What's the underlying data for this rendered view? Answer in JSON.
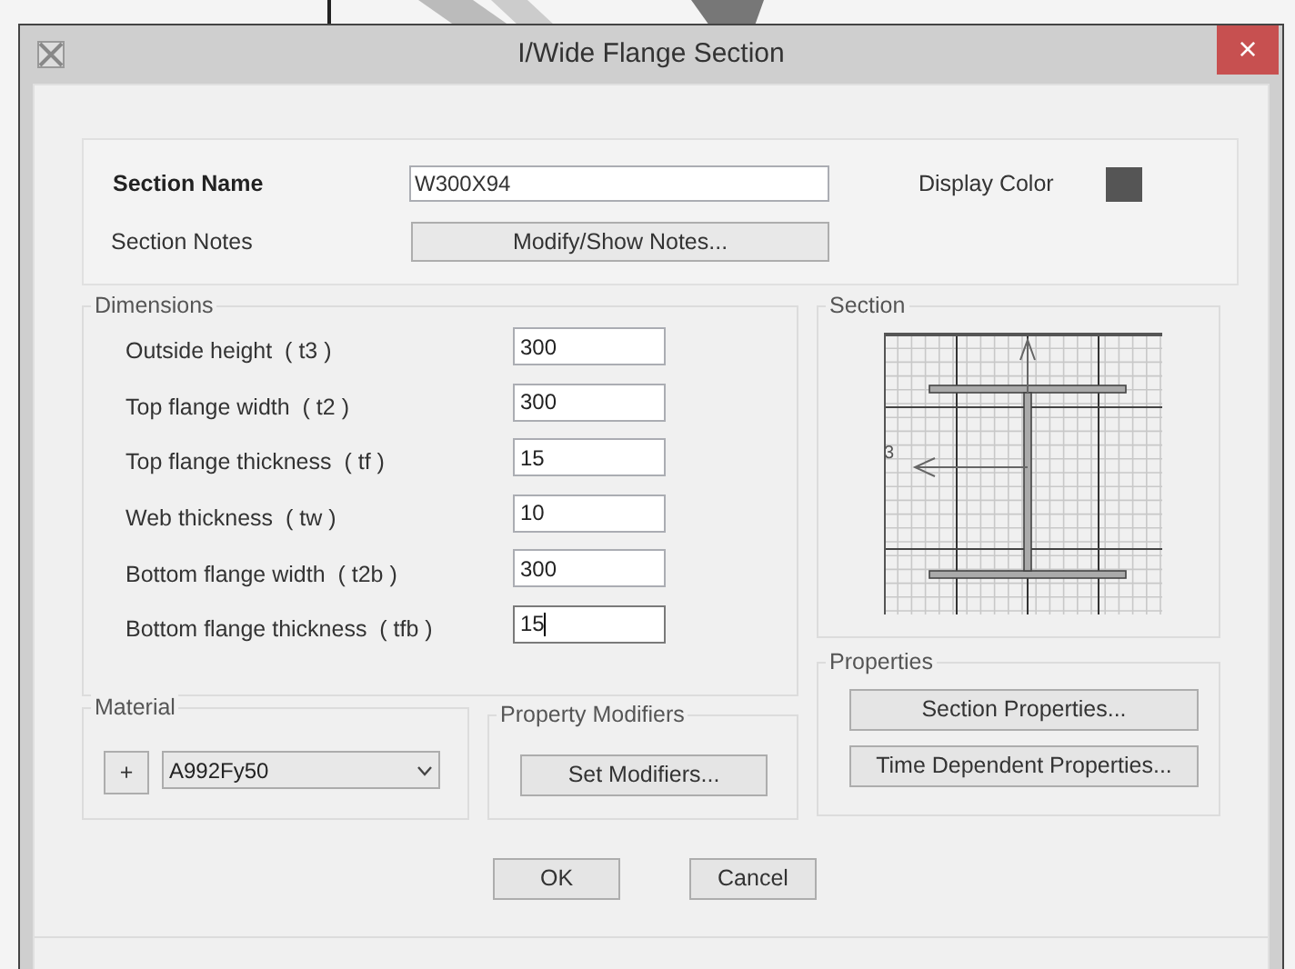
{
  "window": {
    "title": "I/Wide Flange Section",
    "close": "×"
  },
  "section_name": {
    "label": "Section Name",
    "value": "W300X94"
  },
  "display_color": {
    "label": "Display Color",
    "color": "#555555"
  },
  "section_notes": {
    "label": "Section Notes",
    "button": "Modify/Show Notes..."
  },
  "dimensions": {
    "title": "Dimensions",
    "fields": [
      {
        "label": "Outside height  ( t3 )",
        "value": "300",
        "focused": false
      },
      {
        "label": "Top flange width  ( t2 )",
        "value": "300",
        "focused": false
      },
      {
        "label": "Top flange thickness  ( tf )",
        "value": "15",
        "focused": false
      },
      {
        "label": "Web thickness  ( tw )",
        "value": "10",
        "focused": false
      },
      {
        "label": "Bottom flange width  ( t2b )",
        "value": "300",
        "focused": false
      },
      {
        "label": "Bottom flange thickness  ( tfb )",
        "value": "15",
        "focused": true
      }
    ]
  },
  "section": {
    "title": "Section",
    "axis_label": "3"
  },
  "properties": {
    "title": "Properties",
    "buttons": [
      "Section Properties...",
      "Time Dependent Properties..."
    ]
  },
  "material": {
    "title": "Material",
    "add_button": "+",
    "value": "A992Fy50"
  },
  "property_modifiers": {
    "title": "Property Modifiers",
    "button": "Set Modifiers..."
  },
  "buttons": [
    "OK",
    "Cancel"
  ]
}
